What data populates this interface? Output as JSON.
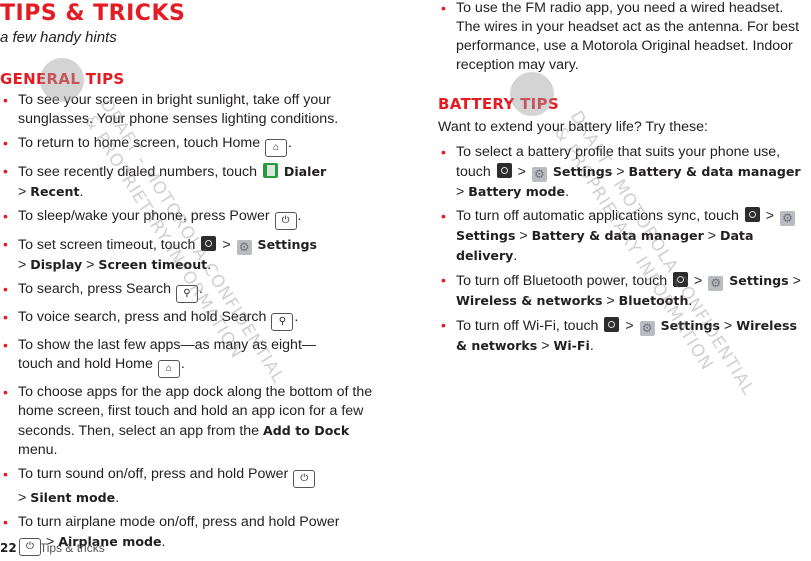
{
  "header": {
    "title": "TIPS & TRICKS",
    "subtitle": "a few handy hints"
  },
  "general": {
    "heading": "GENERAL TIPS",
    "items": [
      {
        "t1": "To see your screen in bright sunlight, take off your sunglasses. Your phone senses lighting conditions."
      },
      {
        "t1": "To return to home screen, touch Home",
        "t2": "."
      },
      {
        "t1": "To see recently dialed numbers, touch",
        "b1": "Dialer",
        "sep": ">",
        "b2": "Recent",
        "t2": "."
      },
      {
        "t1": "To sleep/wake your phone, press Power",
        "t2": "."
      },
      {
        "t1": "To set screen timeout, touch",
        "sep": ">",
        "b1": "Settings",
        "b2": "Display",
        "b3": "Screen timeout",
        "t2": "."
      },
      {
        "t1": "To search, press Search",
        "t2": "."
      },
      {
        "t1": "To voice search, press and hold Search",
        "t2": "."
      },
      {
        "t1": "To show the last few apps—as many as eight—touch and hold Home",
        "t2": "."
      },
      {
        "t1": "To choose apps for the app dock along the bottom of the home screen, first touch and hold an app icon for a few seconds. Then, select an app from the",
        "b1": "Add to Dock",
        "t2": "menu."
      },
      {
        "t1": "To turn sound on/off, press and hold Power",
        "sep": ">",
        "b1": "Silent mode",
        "t2": "."
      },
      {
        "t1": "To turn airplane mode on/off, press and hold Power",
        "sep": ">",
        "b1": "Airplane mode",
        "t2": "."
      }
    ]
  },
  "right": {
    "fm_item": "To use the FM radio app, you need a wired headset. The wires in your headset act as the antenna. For best performance, use a Motorola Original headset. Indoor reception may vary.",
    "battery": {
      "heading": "BATTERY TIPS",
      "intro": "Want to extend your battery life? Try these:",
      "items": [
        {
          "t1": "To select a battery profile that suits your phone use, touch",
          "p1": "Settings",
          "p2": "Battery & data manager",
          "p3": "Battery mode",
          "t2": "."
        },
        {
          "t1": "To turn off automatic applications sync, touch",
          "p1": "Settings",
          "p2": "Battery & data manager",
          "p3": "Data delivery",
          "t2": "."
        },
        {
          "t1": "To turn off Bluetooth power, touch",
          "p1": "Settings",
          "p2": "Wireless & networks",
          "p3": "Bluetooth",
          "t2": "."
        },
        {
          "t1": "To turn off Wi-Fi, touch",
          "p1": "Settings",
          "p2": "Wireless & networks",
          "p3": "Wi-Fi",
          "t2": "."
        }
      ]
    }
  },
  "footer": {
    "page_number": "22",
    "section": "Tips & tricks"
  },
  "watermark": {
    "line1": "DRAFT - MOTOROLA CONFIDENTIAL",
    "line2": "& PROPRIETARY INFORMATION"
  },
  "icons": {
    "bullet": "•",
    "sep": ">",
    "home": "⌂",
    "search": "⚲",
    "power": "⏻",
    "gear": "⚙"
  }
}
